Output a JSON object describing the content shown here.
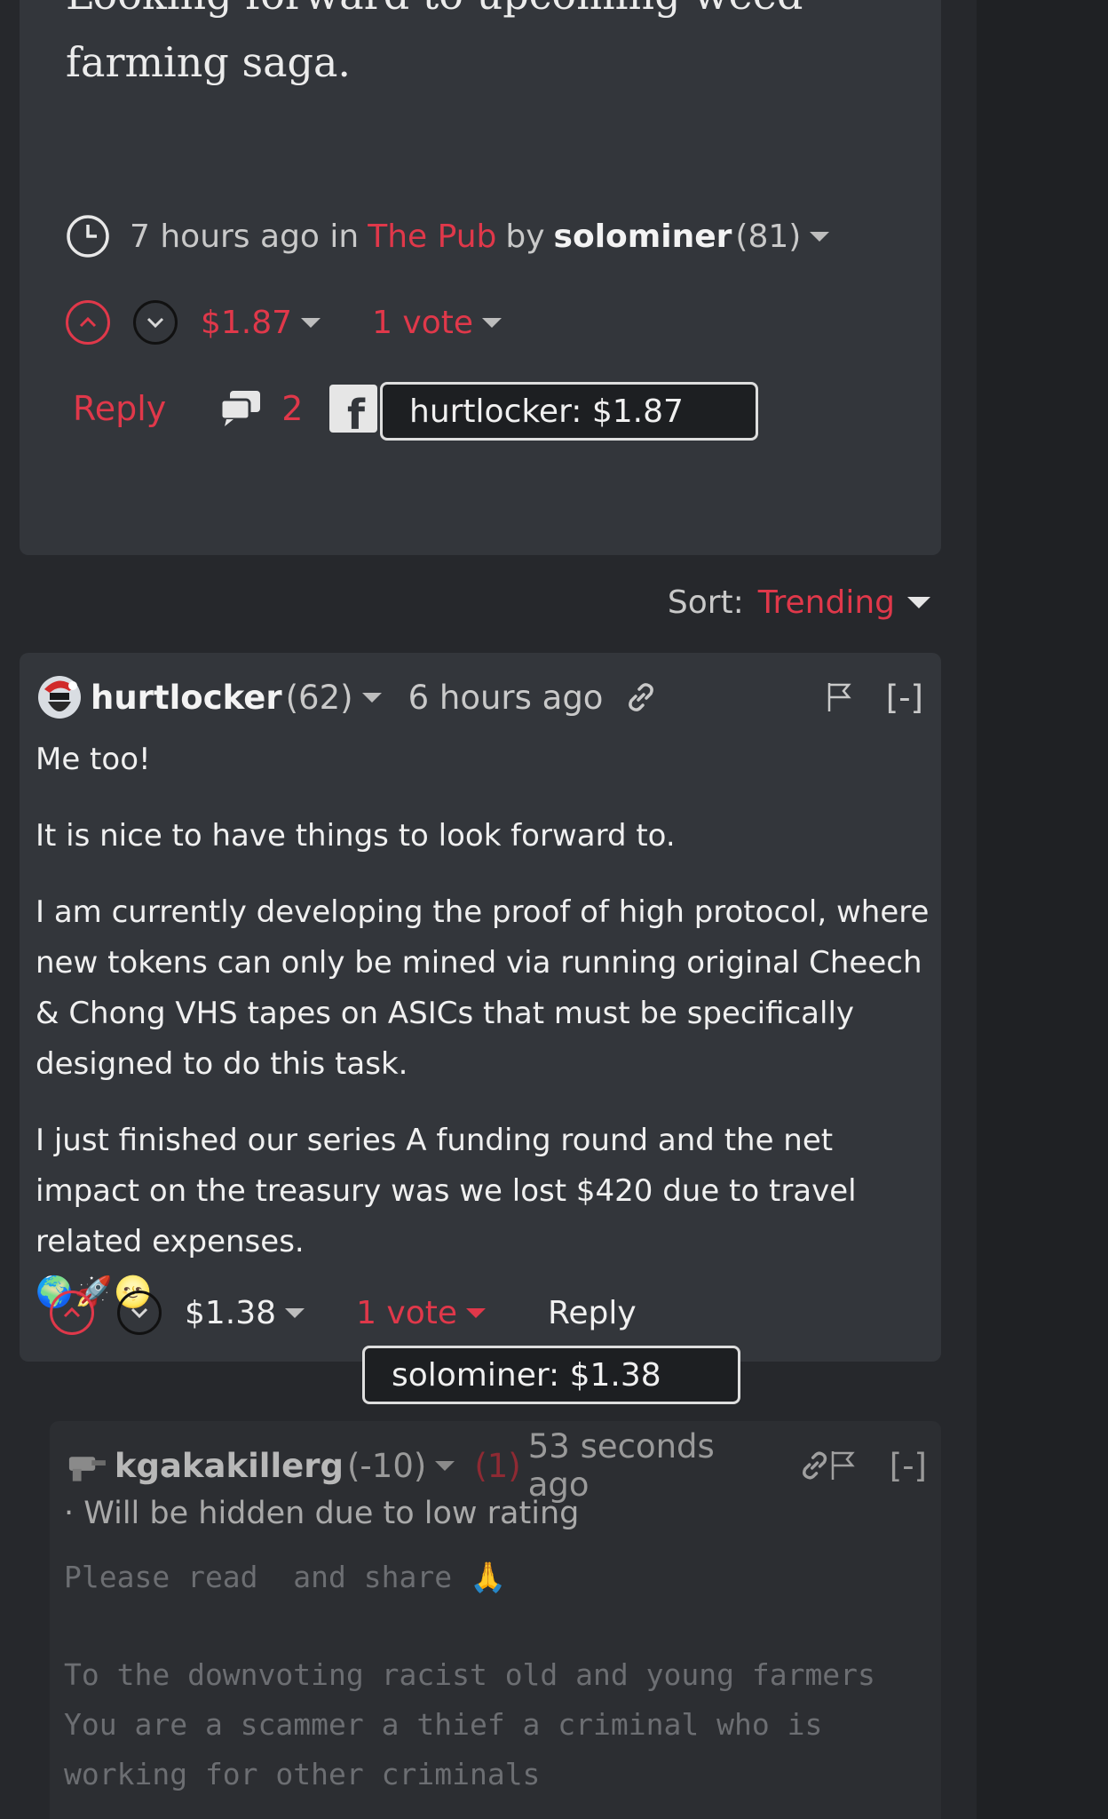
{
  "post": {
    "body_partial_line": "Looking forward to upcoming weed",
    "body_line": "farming saga.",
    "meta": {
      "time": "7 hours ago in",
      "community": "The Pub",
      "by": "by",
      "author": "solominer",
      "rep": "(81)"
    },
    "payout": "$1.87",
    "votes": "1 vote",
    "reply_label": "Reply",
    "comment_count": "2",
    "voter_tooltip": "hurtlocker: $1.87"
  },
  "sort": {
    "label": "Sort:",
    "value": "Trending"
  },
  "comment": {
    "author": "hurtlocker",
    "rep": "(62)",
    "time": "6 hours ago",
    "collapse": "[-]",
    "paragraphs": [
      "Me too!",
      "It is nice to have things to look forward to.",
      "I am currently developing the proof of high protocol, where new tokens can only be mined via running original Cheech & Chong VHS tapes on ASICs that must be specifically designed to do this task.",
      "I just finished our series A funding round and the net impact on the treasury was we lost $420 due to travel related expenses."
    ],
    "emojis": "🌍🚀🌝",
    "payout": "$1.38",
    "votes": "1 vote",
    "reply_label": "Reply",
    "voter_tooltip": "solominer: $1.38"
  },
  "reply": {
    "author": "kgakakillerg",
    "rep": "(-10)",
    "neg_count": "(1)",
    "time": "53 seconds ago",
    "collapse": "[-]",
    "hidden_note": "· Will be hidden due to low rating",
    "line1": "Please read  and share 🙏",
    "line2": "To the downvoting racist old and young farmers",
    "line3": "You are a scammer a thief a criminal who is",
    "line4": "working for other criminals"
  },
  "colors": {
    "accent": "#e0384a",
    "card": "#33363b",
    "background": "#26282c"
  }
}
